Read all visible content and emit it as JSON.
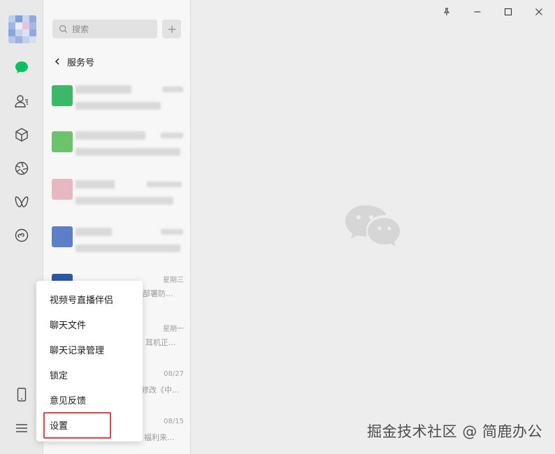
{
  "nav": {
    "items": [
      {
        "name": "chats-icon",
        "active": true
      },
      {
        "name": "contacts-icon"
      },
      {
        "name": "favorites-icon"
      },
      {
        "name": "moments-icon"
      },
      {
        "name": "channels-icon"
      },
      {
        "name": "mini-programs-icon"
      },
      {
        "name": "phone-icon"
      },
      {
        "name": "menu-icon"
      }
    ],
    "accent_color": "#07c160"
  },
  "search": {
    "placeholder": "搜索"
  },
  "breadcrumb": {
    "label": "服务号"
  },
  "chats": [
    {
      "name": "",
      "time": "",
      "preview": ""
    },
    {
      "name": "",
      "time": "",
      "preview": ""
    },
    {
      "name": "",
      "time": "",
      "preview": ""
    },
    {
      "name": "",
      "time": "",
      "preview": ""
    },
    {
      "name": "",
      "time": "星期三",
      "preview": "部署防..."
    },
    {
      "name": "",
      "time": "星期一",
      "preview": "耳机正..."
    },
    {
      "name": "",
      "time": "08/27",
      "preview": "修改《中..."
    },
    {
      "name": "",
      "time": "08/15",
      "preview": "福利来..."
    }
  ],
  "menu": {
    "items": [
      "视频号直播伴侣",
      "聊天文件",
      "聊天记录管理",
      "锁定",
      "意见反馈",
      "设置"
    ],
    "highlighted": "设置"
  },
  "watermark": "掘金技术社区 @ 简鹿办公"
}
